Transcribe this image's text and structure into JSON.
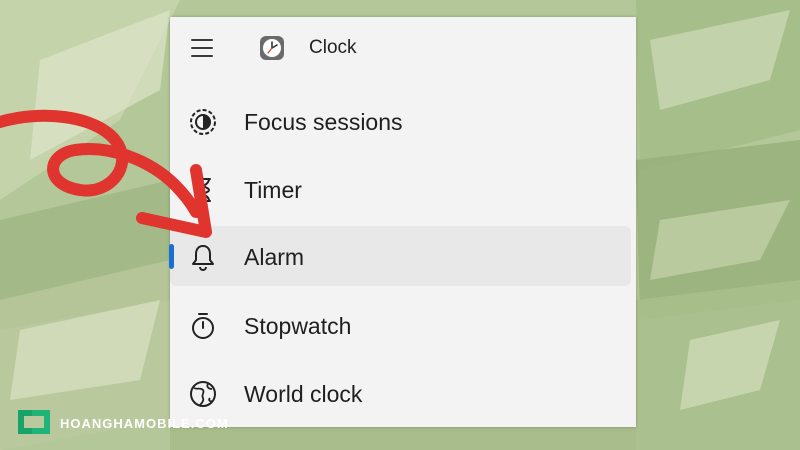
{
  "app": {
    "title": "Clock"
  },
  "nav": {
    "items": [
      {
        "label": "Focus sessions",
        "icon": "focus-sessions-icon",
        "selected": false
      },
      {
        "label": "Timer",
        "icon": "hourglass-icon",
        "selected": false
      },
      {
        "label": "Alarm",
        "icon": "bell-icon",
        "selected": true
      },
      {
        "label": "Stopwatch",
        "icon": "stopwatch-icon",
        "selected": false
      },
      {
        "label": "World clock",
        "icon": "globe-icon",
        "selected": false
      }
    ]
  },
  "watermark": {
    "text": "HOANGHAMOBILE.COM"
  },
  "colors": {
    "accent": "#1a6fd1",
    "arrow": "#e0342f",
    "sidebar_bg": "#f3f3f3",
    "selected_bg": "#e8e8e8"
  }
}
